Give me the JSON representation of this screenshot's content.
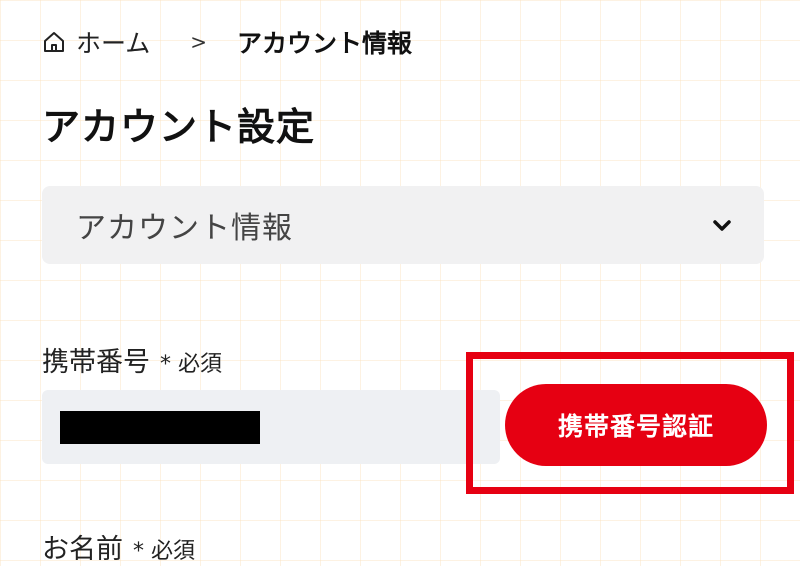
{
  "breadcrumb": {
    "home": "ホーム",
    "separator": ">",
    "current": "アカウント情報",
    "home_icon": "home-icon"
  },
  "page": {
    "title": "アカウント設定"
  },
  "section_select": {
    "value": "アカウント情報",
    "icon": "chevron-down-icon"
  },
  "form": {
    "phone": {
      "label": "携帯番号",
      "required": "* 必須",
      "button_label": "携帯番号認証"
    },
    "name": {
      "label": "お名前",
      "required": "* 必須"
    }
  },
  "colors": {
    "accent": "#e60012",
    "input_bg": "#eef0f3",
    "select_bg": "#f1f1f2",
    "grid": "#fae1be"
  }
}
